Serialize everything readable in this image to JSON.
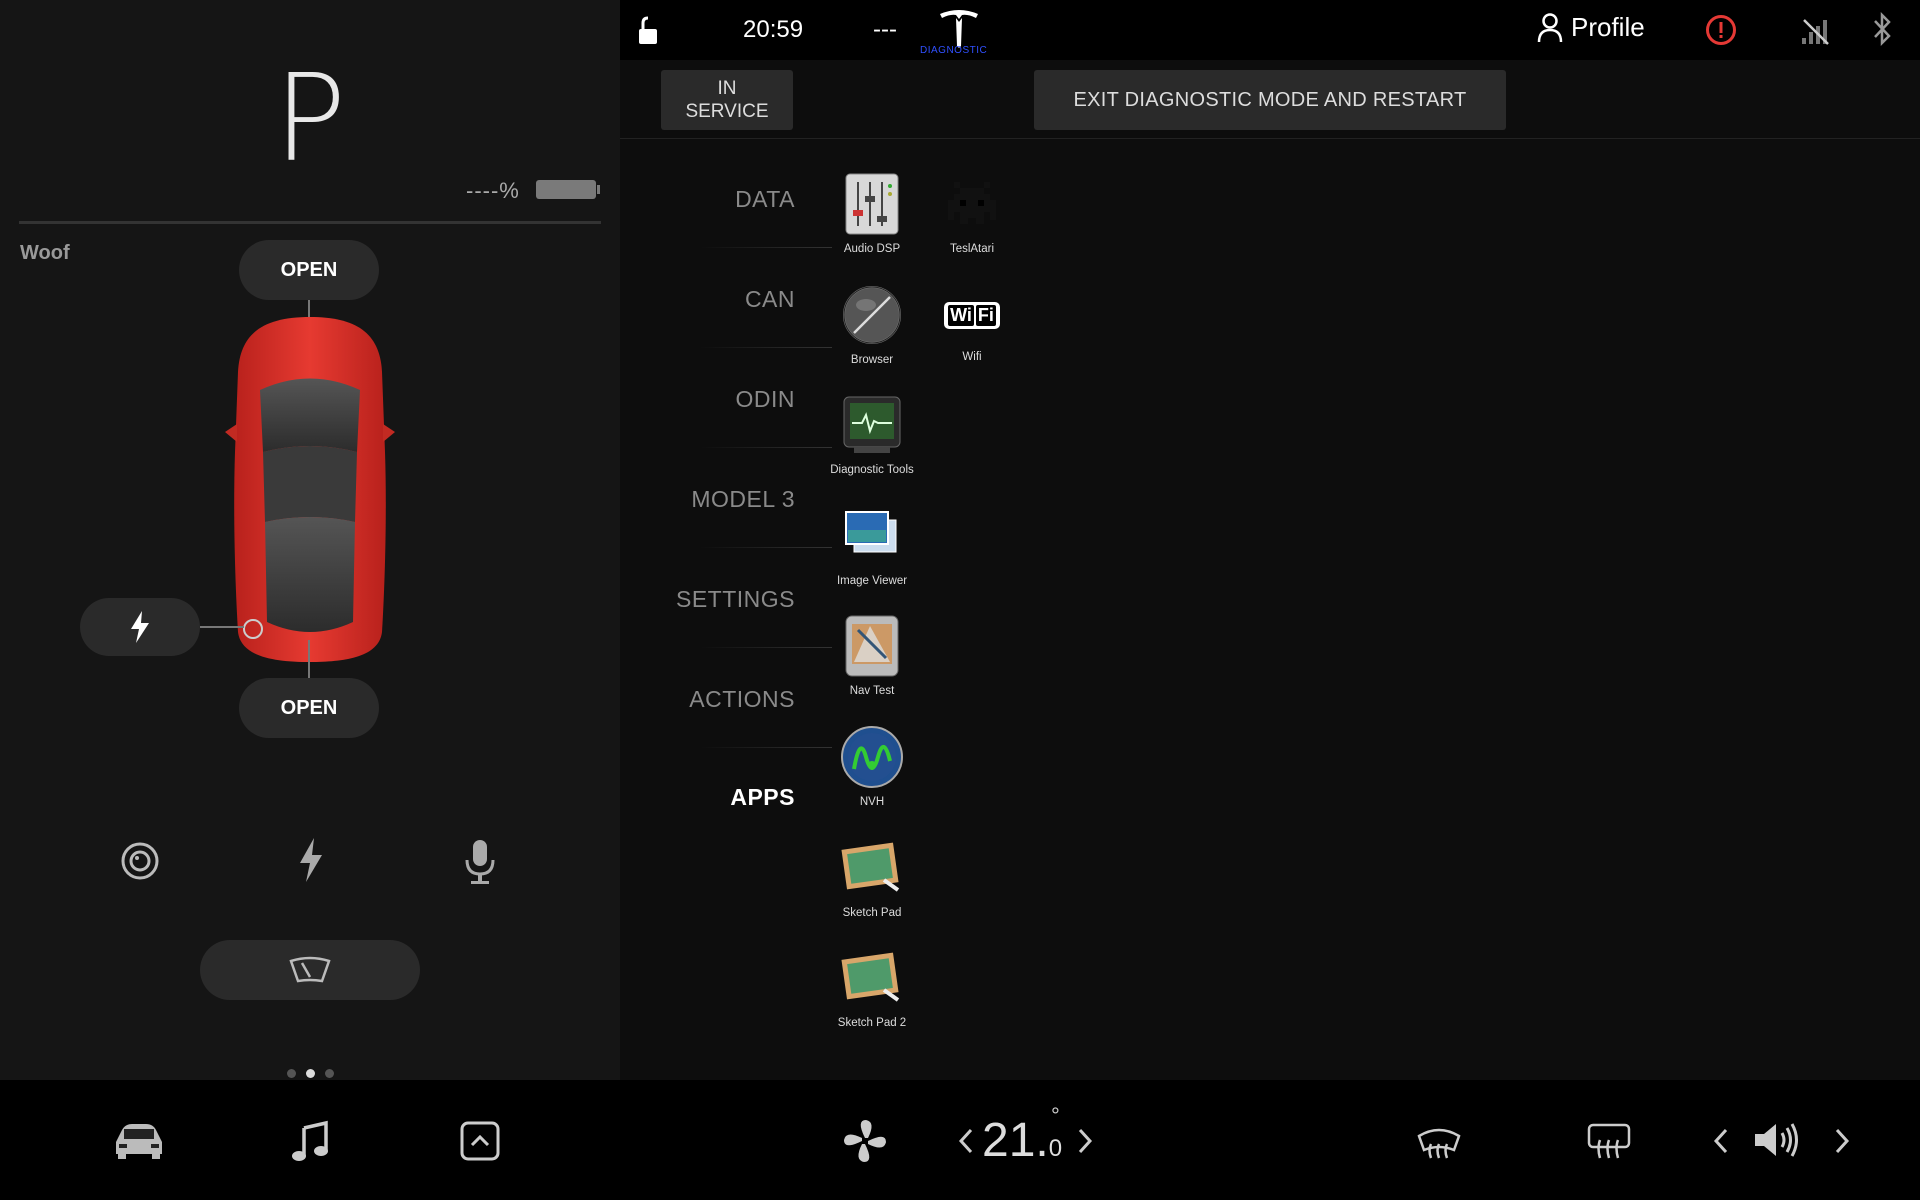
{
  "topbar": {
    "clock": "20:59",
    "dashes": "---",
    "diagnostic_label": "DIAGNOSTIC",
    "profile_label": "Profile"
  },
  "left_panel": {
    "gear": "P",
    "battery_text": "----%",
    "car_name": "Woof",
    "frunk_label": "OPEN",
    "trunk_label": "OPEN"
  },
  "header": {
    "in_service_line1": "IN",
    "in_service_line2": "SERVICE",
    "exit_label": "EXIT DIAGNOSTIC MODE AND RESTART"
  },
  "nav": {
    "items": [
      {
        "label": "DATA",
        "active": false
      },
      {
        "label": "CAN",
        "active": false
      },
      {
        "label": "ODIN",
        "active": false
      },
      {
        "label": "MODEL 3",
        "active": false
      },
      {
        "label": "SETTINGS",
        "active": false
      },
      {
        "label": "ACTIONS",
        "active": false
      },
      {
        "label": "APPS",
        "active": true
      }
    ]
  },
  "apps": [
    {
      "label": "Audio DSP",
      "icon": "audio-dsp-icon"
    },
    {
      "label": "TeslAtari",
      "icon": "space-invader-icon"
    },
    {
      "label": "Browser",
      "icon": "globe-icon"
    },
    {
      "label": "Wifi",
      "icon": "wifi-icon"
    },
    {
      "label": "Diagnostic Tools",
      "icon": "diagnostic-monitor-icon"
    },
    {
      "label": "Image Viewer",
      "icon": "image-viewer-icon"
    },
    {
      "label": "Nav Test",
      "icon": "nav-device-icon"
    },
    {
      "label": "NVH",
      "icon": "nvh-icon"
    },
    {
      "label": "Sketch Pad",
      "icon": "chalkboard-icon"
    },
    {
      "label": "Sketch Pad 2",
      "icon": "chalkboard-icon"
    }
  ],
  "wifi_icon_text": {
    "a": "Wi",
    "b": "Fi"
  },
  "climate": {
    "temp_whole": "21.",
    "temp_decimal": "0",
    "degree": "°"
  },
  "pager": {
    "count": 3,
    "active_index": 1
  },
  "colors": {
    "accent_red": "#e53935",
    "car_red": "#d9302a",
    "diagnostic_blue": "#3050ff"
  }
}
